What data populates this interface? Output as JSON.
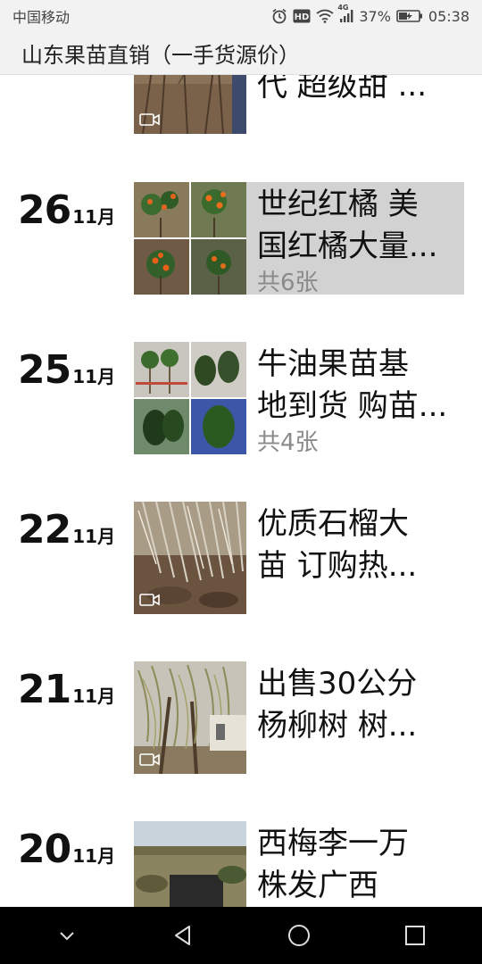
{
  "status_bar": {
    "carrier": "中国移动",
    "network": "4G",
    "battery": "37%",
    "time": "05:38"
  },
  "header": {
    "title": "山东果苗直销（一手货源价）"
  },
  "posts": [
    {
      "day": "",
      "month": "",
      "title_lines": [
        "代 超级甜 ..."
      ],
      "count": "",
      "has_video": true
    },
    {
      "day": "26",
      "month": "11月",
      "title_lines": [
        "世纪红橘 美",
        "国红橘大量..."
      ],
      "count": "共6张",
      "has_video": false,
      "highlighted": true
    },
    {
      "day": "25",
      "month": "11月",
      "title_lines": [
        "牛油果苗基",
        "地到货 购苗..."
      ],
      "count": "共4张",
      "has_video": false
    },
    {
      "day": "22",
      "month": "11月",
      "title_lines": [
        "优质石榴大",
        "苗  订购热..."
      ],
      "count": "",
      "has_video": true
    },
    {
      "day": "21",
      "month": "11月",
      "title_lines": [
        "出售30公分",
        "杨柳树  树..."
      ],
      "count": "",
      "has_video": true
    },
    {
      "day": "20",
      "month": "11月",
      "title_lines": [
        "西梅李一万",
        "株发广西"
      ],
      "count": "",
      "has_video": false
    }
  ],
  "icons": {
    "alarm": "alarm-icon",
    "hd": "hd-icon",
    "wifi": "wifi-icon",
    "signal": "signal-icon",
    "battery": "battery-icon",
    "video": "video-icon",
    "nav_down": "chevron-down-icon",
    "nav_back": "back-icon",
    "nav_home": "home-icon",
    "nav_recent": "recent-apps-icon"
  }
}
